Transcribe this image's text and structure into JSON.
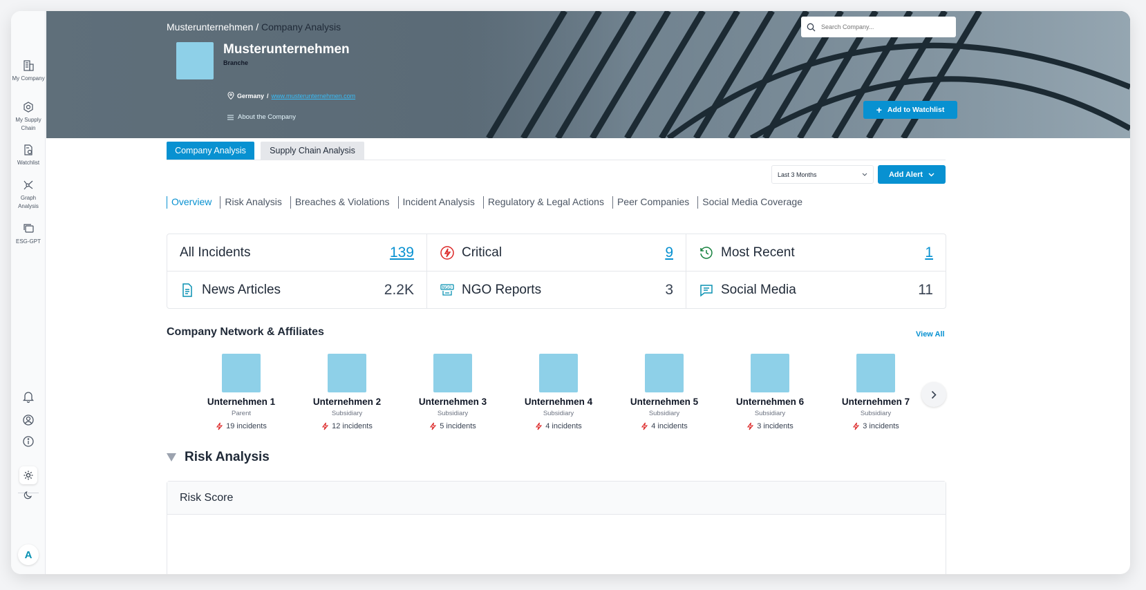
{
  "sidebar": {
    "items": [
      {
        "label": "My Company",
        "icon": "building-icon"
      },
      {
        "label": "My Supply Chain",
        "icon": "supply-chain-icon"
      },
      {
        "label": "Watchlist",
        "icon": "watchlist-icon"
      },
      {
        "label": "Graph Analysis",
        "icon": "graph-icon"
      },
      {
        "label": "ESG-GPT",
        "icon": "chat-icon"
      }
    ],
    "avatar_initial": "A"
  },
  "header": {
    "breadcrumb_parent": "Musterunternehmen",
    "breadcrumb_separator": "/",
    "breadcrumb_current": "Company Analysis",
    "company_name": "Musterunternehmen",
    "sector": "Branche",
    "country": "Germany",
    "location_separator": "/",
    "website": "www.musterunternehmen.com",
    "about_label": "About the Company",
    "search_placeholder": "Search Company...",
    "watchlist_label": "Add to Watchlist"
  },
  "tabs": {
    "active": "Company Analysis",
    "inactive": "Supply Chain Analysis"
  },
  "controls": {
    "period": "Last 3 Months",
    "alert_label": "Add Alert"
  },
  "subtabs": [
    "Overview",
    "Risk Analysis",
    "Breaches & Violations",
    "Incident Analysis",
    "Regulatory & Legal Actions",
    "Peer Companies",
    "Social Media Coverage"
  ],
  "stats": [
    {
      "label": "All Incidents",
      "value": "139",
      "link": true
    },
    {
      "label": "Critical",
      "value": "9",
      "link": true
    },
    {
      "label": "Most Recent",
      "value": "1",
      "link": true
    },
    {
      "label": "News Articles",
      "value": "2.2K",
      "link": false
    },
    {
      "label": "NGO Reports",
      "value": "3",
      "link": false
    },
    {
      "label": "Social Media",
      "value": "11",
      "link": false
    }
  ],
  "network": {
    "title": "Company Network & Affiliates",
    "view_all": "View All",
    "affiliates": [
      {
        "name": "Unternehmen 1",
        "relation": "Parent",
        "incidents": "19 incidents"
      },
      {
        "name": "Unternehmen 2",
        "relation": "Subsidiary",
        "incidents": "12 incidents"
      },
      {
        "name": "Unternehmen 3",
        "relation": "Subsidiary",
        "incidents": "5 incidents"
      },
      {
        "name": "Unternehmen 4",
        "relation": "Subsidiary",
        "incidents": "4 incidents"
      },
      {
        "name": "Unternehmen 5",
        "relation": "Subsidiary",
        "incidents": "4 incidents"
      },
      {
        "name": "Unternehmen 6",
        "relation": "Subsidiary",
        "incidents": "3 incidents"
      },
      {
        "name": "Unternehmen 7",
        "relation": "Subsidiary",
        "incidents": "3 incidents"
      }
    ]
  },
  "risk": {
    "title": "Risk Analysis",
    "card_title": "Risk Score"
  },
  "colors": {
    "accent": "#0891d1",
    "logo_placeholder": "#8ed0e8",
    "critical": "#dc2626",
    "recent": "#15803d"
  }
}
